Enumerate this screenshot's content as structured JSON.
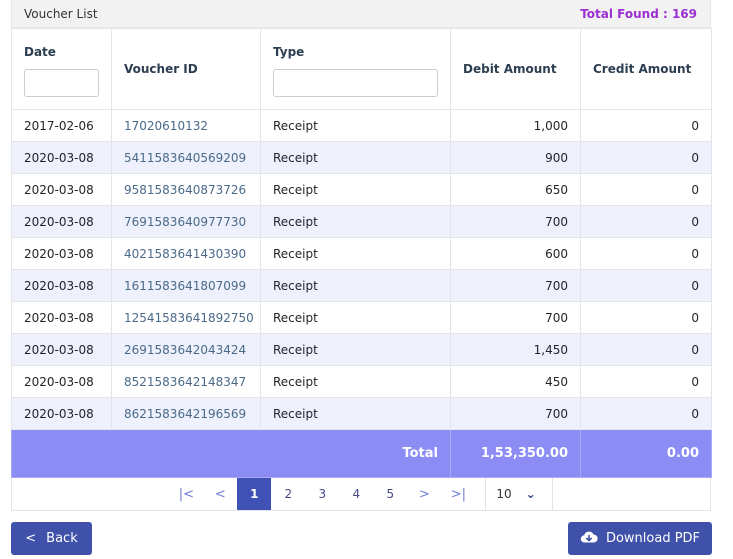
{
  "header": {
    "title": "Voucher List",
    "total_found": "Total Found : 169"
  },
  "columns": {
    "date": "Date",
    "voucher_id": "Voucher ID",
    "type": "Type",
    "debit": "Debit Amount",
    "credit": "Credit Amount"
  },
  "rows": [
    {
      "date": "2017-02-06",
      "voucher_id": "17020610132",
      "type": "Receipt",
      "debit": "1,000",
      "credit": "0"
    },
    {
      "date": "2020-03-08",
      "voucher_id": "5411583640569209",
      "type": "Receipt",
      "debit": "900",
      "credit": "0"
    },
    {
      "date": "2020-03-08",
      "voucher_id": "9581583640873726",
      "type": "Receipt",
      "debit": "650",
      "credit": "0"
    },
    {
      "date": "2020-03-08",
      "voucher_id": "7691583640977730",
      "type": "Receipt",
      "debit": "700",
      "credit": "0"
    },
    {
      "date": "2020-03-08",
      "voucher_id": "4021583641430390",
      "type": "Receipt",
      "debit": "600",
      "credit": "0"
    },
    {
      "date": "2020-03-08",
      "voucher_id": "1611583641807099",
      "type": "Receipt",
      "debit": "700",
      "credit": "0"
    },
    {
      "date": "2020-03-08",
      "voucher_id": "12541583641892750",
      "type": "Receipt",
      "debit": "700",
      "credit": "0"
    },
    {
      "date": "2020-03-08",
      "voucher_id": "2691583642043424",
      "type": "Receipt",
      "debit": "1,450",
      "credit": "0"
    },
    {
      "date": "2020-03-08",
      "voucher_id": "8521583642148347",
      "type": "Receipt",
      "debit": "450",
      "credit": "0"
    },
    {
      "date": "2020-03-08",
      "voucher_id": "8621583642196569",
      "type": "Receipt",
      "debit": "700",
      "credit": "0"
    }
  ],
  "totals": {
    "label": "Total",
    "debit": "1,53,350.00",
    "credit": "0.00"
  },
  "pagination": {
    "first": "|<",
    "prev": "<",
    "next": ">",
    "last": ">|",
    "pages": [
      "1",
      "2",
      "3",
      "4",
      "5"
    ],
    "active_page": "1",
    "per_page": "10",
    "per_page_chevron": "⌄"
  },
  "buttons": {
    "back": "Back",
    "back_icon": "<",
    "download": "Download PDF"
  },
  "icons": {
    "back": "chevron-left-icon",
    "download": "cloud-download-icon"
  },
  "colors": {
    "accent": "#3f51b5",
    "total_row": "#8c8cf5",
    "total_found": "#9b2fd1",
    "stripe": "#eef0fb"
  }
}
